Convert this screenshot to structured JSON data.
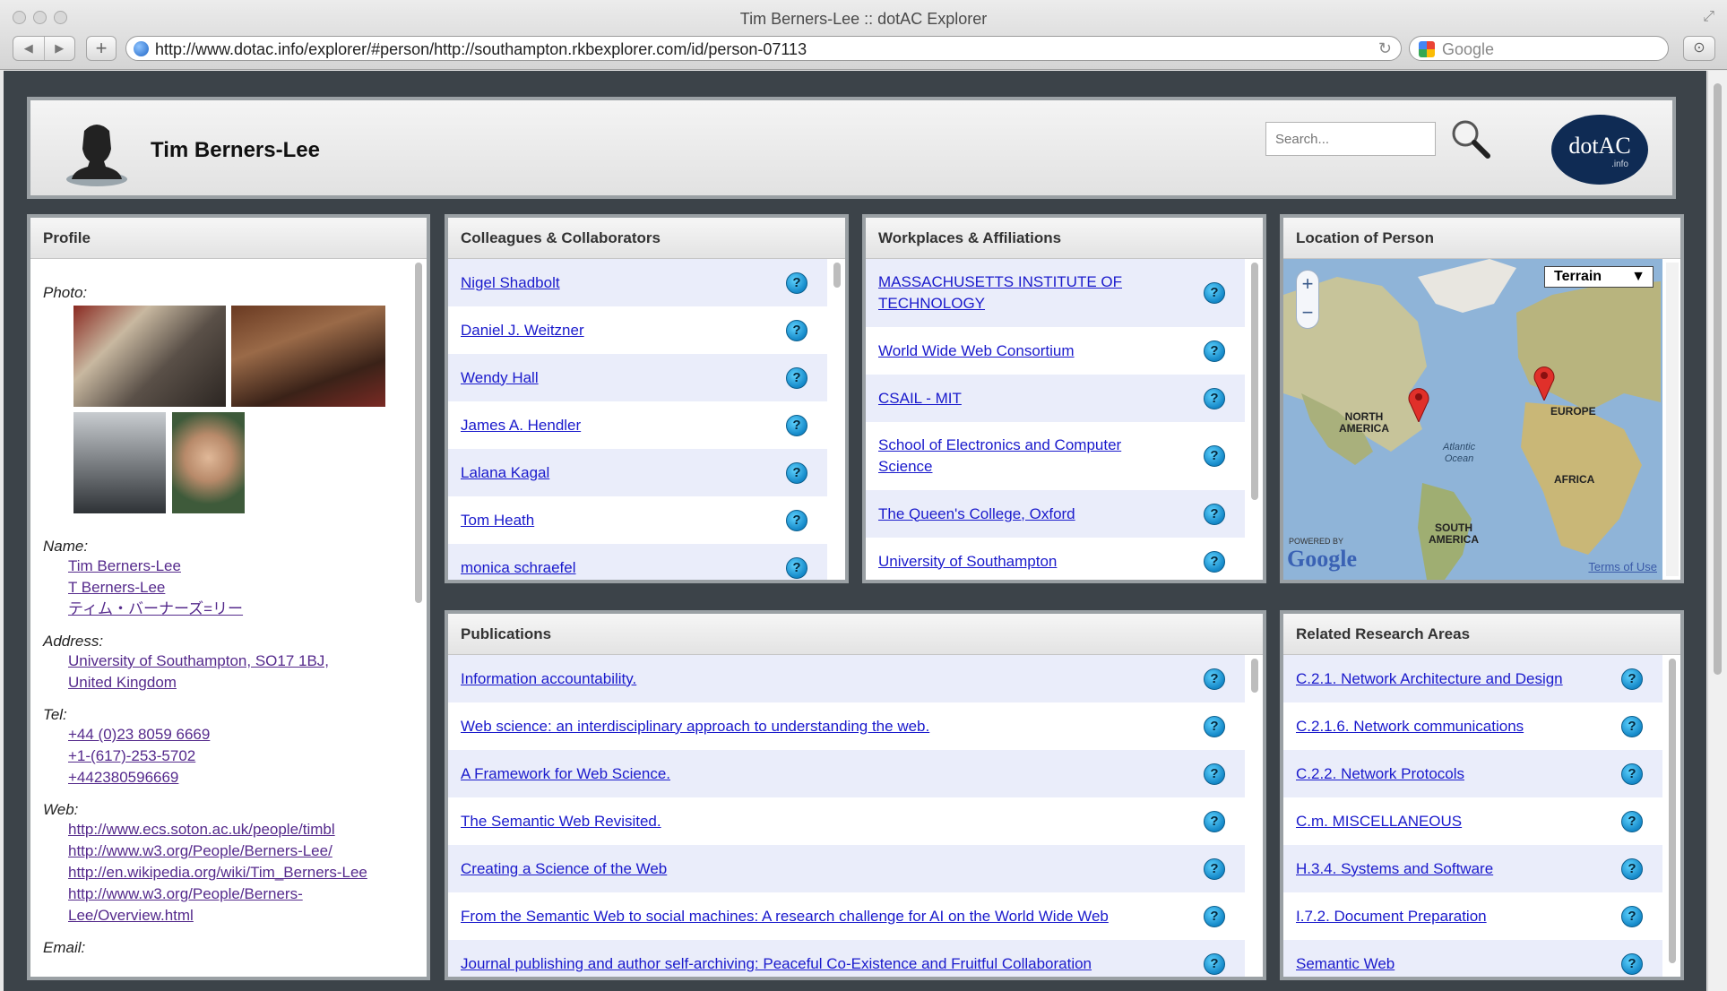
{
  "browser": {
    "window_title": "Tim Berners-Lee :: dotAC Explorer",
    "url": "http://www.dotac.info/explorer/#person/http://southampton.rkbexplorer.com/id/person-07113",
    "search_placeholder": "Google"
  },
  "header": {
    "person_name": "Tim Berners-Lee",
    "search_placeholder": "Search...",
    "logo_text": "dotAC",
    "logo_subtext": ".info"
  },
  "profile": {
    "title": "Profile",
    "photo_label": "Photo:",
    "name_label": "Name:",
    "names": [
      "Tim Berners-Lee",
      "T Berners-Lee",
      "ティム・バーナーズ=リー"
    ],
    "address_label": "Address:",
    "address": [
      "University of Southampton, SO17 1BJ,",
      "United Kingdom"
    ],
    "tel_label": "Tel:",
    "tels": [
      "+44 (0)23 8059 6669",
      "+1-(617)-253-5702",
      "+442380596669"
    ],
    "web_label": "Web:",
    "webs": [
      "http://www.ecs.soton.ac.uk/people/timbl",
      "http://www.w3.org/People/Berners-Lee/",
      "http://en.wikipedia.org/wiki/Tim_Berners-Lee",
      "http://www.w3.org/People/Berners-",
      "Lee/Overview.html"
    ],
    "email_label": "Email:"
  },
  "colleagues": {
    "title": "Colleagues & Collaborators",
    "items": [
      "Nigel Shadbolt",
      "Daniel J. Weitzner",
      "Wendy Hall",
      "James A. Hendler",
      "Lalana Kagal",
      "Tom Heath",
      "monica schraefel"
    ]
  },
  "workplaces": {
    "title": "Workplaces & Affiliations",
    "items": [
      [
        "MASSACHUSETTS INSTITUTE OF",
        "TECHNOLOGY"
      ],
      [
        "World Wide Web Consortium"
      ],
      [
        "CSAIL - MIT"
      ],
      [
        "School of Electronics and Computer",
        "Science"
      ],
      [
        "The Queen's College, Oxford"
      ],
      [
        "University of Southampton"
      ]
    ]
  },
  "location": {
    "title": "Location of Person",
    "map_type": "Terrain",
    "zoom_in": "+",
    "zoom_out": "−",
    "labels": {
      "north_america": "NORTH\nAMERICA",
      "europe": "EUROPE",
      "atlantic": "Atlantic\nOcean",
      "africa": "AFRICA",
      "south_america": "SOUTH\nAMERICA"
    },
    "powered_by": "POWERED BY",
    "google": "Google",
    "terms": "Terms of Use"
  },
  "publications": {
    "title": "Publications",
    "items": [
      "Information accountability.",
      "Web science: an interdisciplinary approach to understanding the web.",
      "A Framework for Web Science.",
      "The Semantic Web Revisited.",
      "Creating a Science of the Web",
      "From the Semantic Web to social machines: A research challenge for AI on the World Wide Web",
      "Journal publishing and author self-archiving: Peaceful Co-Existence and Fruitful Collaboration"
    ]
  },
  "research": {
    "title": "Related Research Areas",
    "items": [
      "C.2.1. Network Architecture and Design",
      "C.2.1.6. Network communications",
      "C.2.2. Network Protocols",
      "C.m. MISCELLANEOUS",
      "H.3.4. Systems and Software",
      "I.7.2. Document Preparation",
      "Semantic Web"
    ]
  },
  "icons": {
    "info": "?",
    "back": "◀",
    "forward": "▶",
    "add_tab": "+",
    "reload": "↻",
    "download": "⊙",
    "resize": "⤢"
  }
}
